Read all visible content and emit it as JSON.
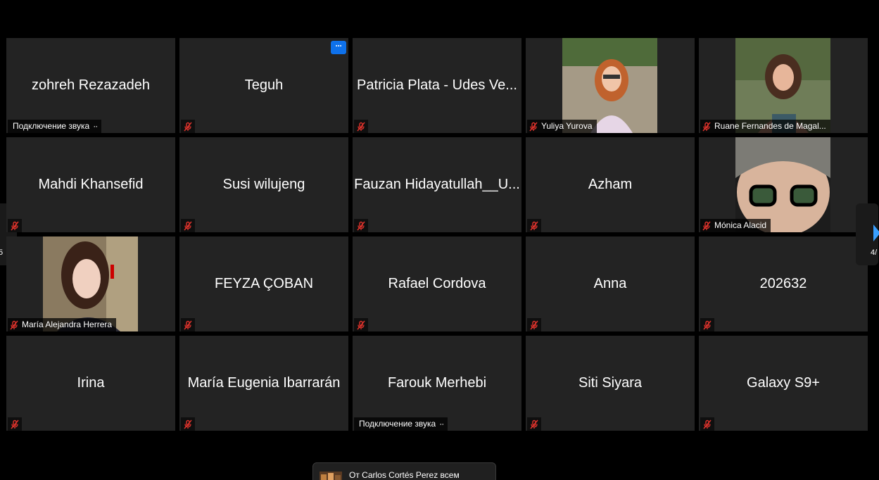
{
  "colors": {
    "tile_bg": "#232323",
    "muted_mic": "#e0332c",
    "more_button": "#0e71eb",
    "nav_arrow": "#3aa0ff"
  },
  "nav": {
    "left_page": "5",
    "right_page": "4/"
  },
  "tiles": [
    {
      "name": "zohreh Rezazadeh",
      "label": "Подключение звука",
      "label_dots": "··",
      "type": "connecting"
    },
    {
      "name": "Teguh",
      "more_button": "···",
      "type": "muted"
    },
    {
      "name": "Patricia Plata - Udes Ve...",
      "type": "muted"
    },
    {
      "name": "Yuliya Yurova",
      "label": "Yuliya Yurova",
      "type": "video",
      "icon": "person-photo"
    },
    {
      "name": "Ruane Fernandes de Magal...",
      "label": "Ruane Fernandes de Magal...",
      "type": "video",
      "icon": "person-photo"
    },
    {
      "name": "Mahdi Khansefid",
      "type": "muted"
    },
    {
      "name": "Susi wilujeng",
      "type": "muted"
    },
    {
      "name": "Fauzan Hidayatullah__U...",
      "type": "muted"
    },
    {
      "name": "Azham",
      "type": "muted"
    },
    {
      "name": "Mónica Alacid",
      "label": "Mónica Alacid",
      "type": "video",
      "icon": "person-photo"
    },
    {
      "name": "María Alejandra Herrera",
      "label": "María Alejandra Herrera",
      "type": "video",
      "icon": "person-photo"
    },
    {
      "name": "FEYZA ÇOBAN",
      "type": "muted"
    },
    {
      "name": "Rafael Cordova",
      "type": "muted"
    },
    {
      "name": "Anna",
      "type": "muted"
    },
    {
      "name": "202632",
      "type": "muted"
    },
    {
      "name": "Irina",
      "type": "muted"
    },
    {
      "name": "María Eugenia Ibarrarán",
      "type": "muted"
    },
    {
      "name": "Farouk Merhebi",
      "label": "Подключение звука",
      "label_dots": "··",
      "type": "connecting"
    },
    {
      "name": "Siti Siyara",
      "type": "muted"
    },
    {
      "name": "Galaxy S9+",
      "type": "muted"
    }
  ],
  "chat_notification": {
    "text": "От Carlos Cortés Perez всем"
  }
}
